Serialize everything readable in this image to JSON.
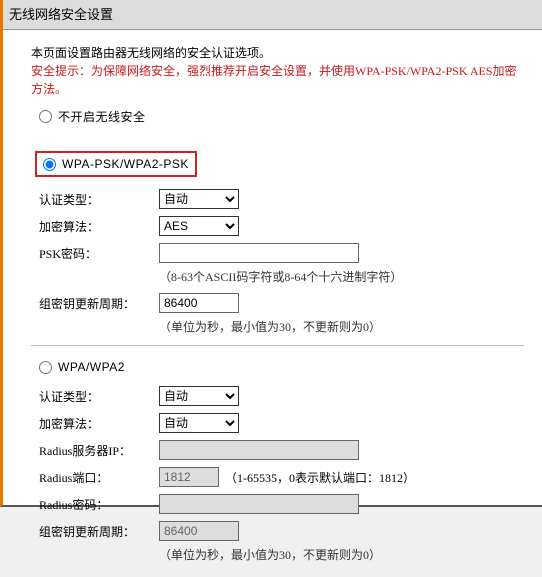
{
  "header": "无线网络安全设置",
  "intro_line1": "本页面设置路由器无线网络的安全认证选项。",
  "intro_tip": "安全提示：为保障网络安全，强烈推荐开启安全设置，并使用WPA-PSK/WPA2-PSK AES加密方法。",
  "radio_off": "不开启无线安全",
  "radio_psk": "WPA-PSK/WPA2-PSK",
  "radio_wpa": "WPA/WPA2",
  "labels": {
    "auth": "认证类型：",
    "encrypt": "加密算法：",
    "psk": "PSK密码：",
    "rekey": "组密钥更新周期：",
    "radius_ip": "Radius服务器IP：",
    "radius_port": "Radius端口：",
    "radius_pw": "Radius密码："
  },
  "opts": {
    "auto": "自动",
    "aes": "AES"
  },
  "psk_section": {
    "auth_val": "自动",
    "encrypt_val": "AES",
    "psk_val": "",
    "psk_hint": "（8-63个ASCII码字符或8-64个十六进制字符）",
    "rekey_val": "86400",
    "rekey_hint": "（单位为秒，最小值为30，不更新则为0）"
  },
  "wpa_section": {
    "auth_val": "自动",
    "encrypt_val": "自动",
    "radius_ip_val": "",
    "radius_port_val": "1812",
    "radius_port_hint": "（1-65535，0表示默认端口：1812）",
    "radius_pw_val": "",
    "rekey_val": "86400",
    "rekey_hint": "（单位为秒，最小值为30，不更新则为0）"
  }
}
